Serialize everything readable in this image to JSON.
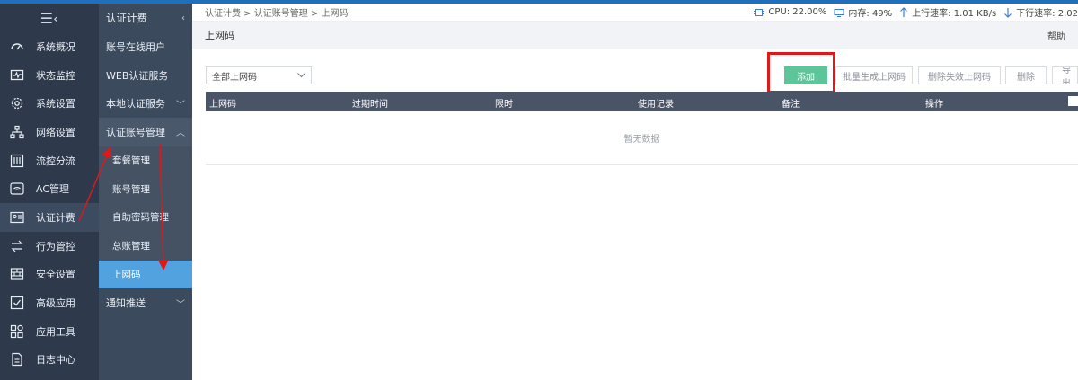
{
  "topbar": {
    "breadcrumb": "认证计费 > 认证账号管理 > 上网码",
    "cpu": "CPU: 22.00%",
    "memory": "内存: 49%",
    "upload": "上行速率: 1.01 KB/s",
    "download": "下行速率: 2.02"
  },
  "sidebar": {
    "items": [
      {
        "label": "系统概况",
        "icon": "dashboard-icon"
      },
      {
        "label": "状态监控",
        "icon": "monitor-icon"
      },
      {
        "label": "系统设置",
        "icon": "gear-icon"
      },
      {
        "label": "网络设置",
        "icon": "network-icon"
      },
      {
        "label": "流控分流",
        "icon": "sliders-icon"
      },
      {
        "label": "AC管理",
        "icon": "wifi-icon"
      },
      {
        "label": "认证计费",
        "icon": "id-card-icon"
      },
      {
        "label": "行为管控",
        "icon": "arrows-icon"
      },
      {
        "label": "安全设置",
        "icon": "firewall-icon"
      },
      {
        "label": "高级应用",
        "icon": "checklist-icon"
      },
      {
        "label": "应用工具",
        "icon": "apps-icon"
      },
      {
        "label": "日志中心",
        "icon": "document-icon"
      }
    ]
  },
  "subnav": {
    "title": "认证计费",
    "items": {
      "online_users": "账号在线用户",
      "web_auth": "WEB认证服务",
      "local_auth": "本地认证服务",
      "account_mgmt": "认证账号管理",
      "package_mgmt": "套餐管理",
      "account": "账号管理",
      "self_password": "自助密码管理",
      "ledger": "总账管理",
      "net_code": "上网码",
      "notify": "通知推送"
    }
  },
  "page": {
    "title": "上网码",
    "help": "帮助"
  },
  "toolbar": {
    "filter_value": "全部上网码",
    "add": "添加",
    "batch": "批量生成上网码",
    "delete_invalid": "删除失效上网码",
    "delete": "删除",
    "export": "导出"
  },
  "table": {
    "columns": [
      "上网码",
      "过期时间",
      "限时",
      "使用记录",
      "备注",
      "操作"
    ],
    "empty": "暂无数据"
  },
  "colors": {
    "sidebar": "#2e3a4b",
    "subnav": "#3c4a5d",
    "active": "#51a2de",
    "primary_button": "#5cc59a",
    "highlight": "#e01818"
  }
}
